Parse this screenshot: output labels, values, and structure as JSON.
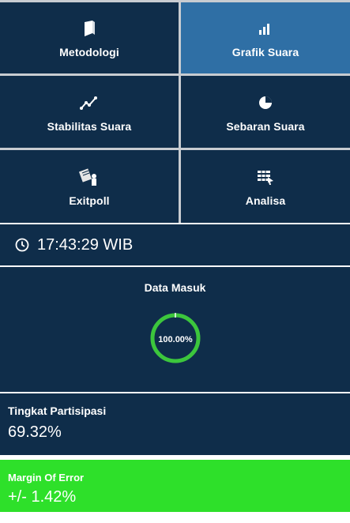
{
  "menu": {
    "tiles": [
      {
        "label": "Metodologi",
        "icon": "book-icon",
        "active": false
      },
      {
        "label": "Grafik Suara",
        "icon": "bar-chart-icon",
        "active": true
      },
      {
        "label": "Stabilitas Suara",
        "icon": "line-trend-icon",
        "active": false
      },
      {
        "label": "Sebaran Suara",
        "icon": "pie-chart-icon",
        "active": false
      },
      {
        "label": "Exitpoll",
        "icon": "exitpoll-icon",
        "active": false
      },
      {
        "label": "Analisa",
        "icon": "analysis-icon",
        "active": false
      }
    ]
  },
  "clock": {
    "time": "17:43:29 WIB",
    "icon": "clock-icon"
  },
  "data_masuk": {
    "title": "Data Masuk",
    "percent_label": "100.00%",
    "progress": 1.0
  },
  "participation": {
    "label": "Tingkat Partisipasi",
    "value": "69.32%"
  },
  "margin_error": {
    "label": "Margin Of Error",
    "value": "+/- 1.42%"
  },
  "colors": {
    "tile_bg": "#0f2d4a",
    "tile_active": "#2f6fa5",
    "gauge_green": "#3cc63c",
    "margin_green": "#2ee02a",
    "divider": "#c8ccd1"
  }
}
